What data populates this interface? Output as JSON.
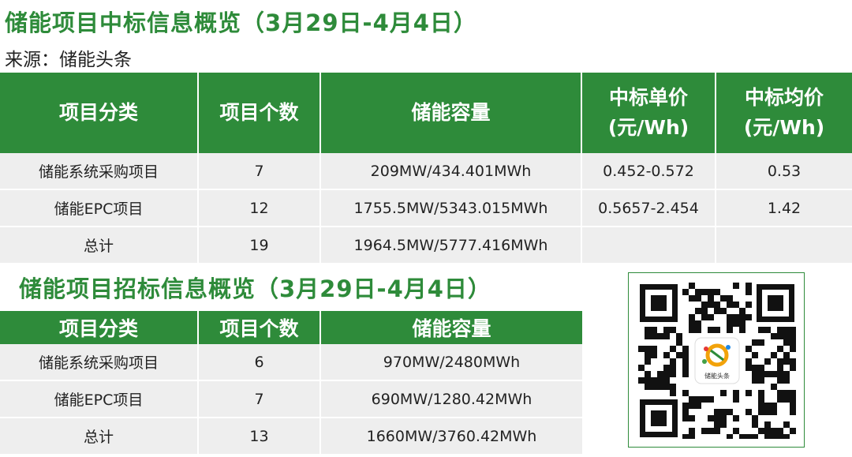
{
  "win_section": {
    "title": "储能项目中标信息概览（3月29日-4月4日）",
    "source": "来源：储能头条",
    "headers": {
      "category": "项目分类",
      "count": "项目个数",
      "capacity": "储能容量",
      "unit_price_line1": "中标单价",
      "unit_price_line2": "(元/Wh)",
      "avg_price_line1": "中标均价",
      "avg_price_line2": "(元/Wh)"
    },
    "rows": [
      {
        "category": "储能系统采购项目",
        "count": "7",
        "capacity": "209MW/434.401MWh",
        "unit_price": "0.452-0.572",
        "avg_price": "0.53"
      },
      {
        "category": "储能EPC项目",
        "count": "12",
        "capacity": "1755.5MW/5343.015MWh",
        "unit_price": "0.5657-2.454",
        "avg_price": "1.42"
      },
      {
        "category": "总计",
        "count": "19",
        "capacity": "1964.5MW/5777.416MWh",
        "unit_price": "",
        "avg_price": ""
      }
    ]
  },
  "bid_section": {
    "title": "储能项目招标信息概览（3月29日-4月4日）",
    "headers": {
      "category": "项目分类",
      "count": "项目个数",
      "capacity": "储能容量"
    },
    "rows": [
      {
        "category": "储能系统采购项目",
        "count": "6",
        "capacity": "970MW/2480MWh"
      },
      {
        "category": "储能EPC项目",
        "count": "7",
        "capacity": "690MW/1280.42MWh"
      },
      {
        "category": "总计",
        "count": "13",
        "capacity": "1660MW/3760.42MWh"
      }
    ]
  },
  "qr": {
    "logo_text": "储能头条",
    "icon": "qr-code-icon"
  },
  "colors": {
    "brand_green": "#2e8b3a",
    "row_gray": "#eeeeee"
  }
}
